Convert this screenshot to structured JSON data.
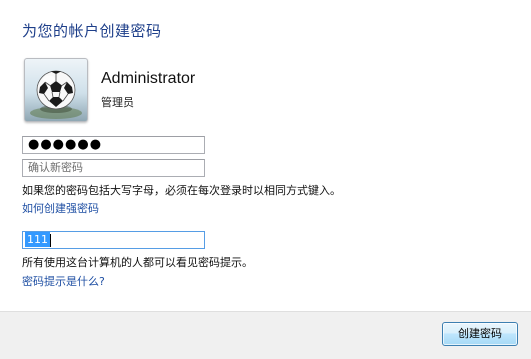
{
  "header": {
    "title": "为您的帐户创建密码"
  },
  "user": {
    "name": "Administrator",
    "role": "管理员",
    "avatar_icon": "soccer-ball-icon"
  },
  "form": {
    "password_value": "●●●●●●",
    "confirm_placeholder": "确认新密码",
    "case_note": "如果您的密码包括大写字母，必须在每次登录时以相同方式键入。",
    "strong_password_link": "如何创建强密码",
    "hint_value": "111",
    "hint_note": "所有使用这台计算机的人都可以看见密码提示。",
    "hint_help_link": "密码提示是什么?"
  },
  "footer": {
    "create_button": "创建密码"
  },
  "colors": {
    "title": "#1e3f8a",
    "link": "#1f4fa3",
    "selection": "#3399ff"
  }
}
